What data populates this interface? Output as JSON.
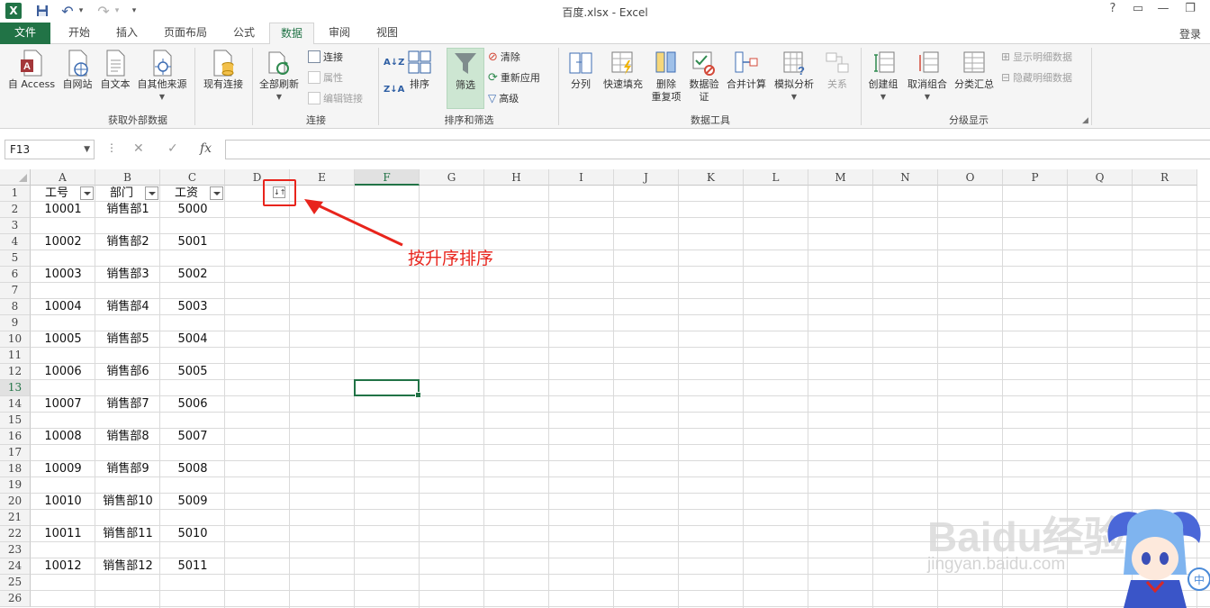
{
  "window": {
    "title": "百度.xlsx - Excel",
    "help": "?",
    "restore_ribbon": "▭",
    "minimize": "—",
    "restore": "❐"
  },
  "quick_access": {
    "excel_logo": "X",
    "save_tip": "save",
    "undo": "↶",
    "redo": "↷",
    "customize": "▾"
  },
  "tabs": [
    {
      "label": "文件",
      "kind": "file"
    },
    {
      "label": "开始"
    },
    {
      "label": "插入"
    },
    {
      "label": "页面布局"
    },
    {
      "label": "公式"
    },
    {
      "label": "数据",
      "active": true
    },
    {
      "label": "审阅"
    },
    {
      "label": "视图"
    }
  ],
  "account": {
    "login": "登录"
  },
  "ribbon": {
    "get_external": {
      "label": "获取外部数据",
      "access": "自 Access",
      "web": "自网站",
      "text": "自文本",
      "other": "自其他来源",
      "existing": "现有连接"
    },
    "connections": {
      "label": "连接",
      "refresh_all": "全部刷新",
      "connections": "连接",
      "properties": "属性",
      "edit_links": "编辑链接"
    },
    "sort_filter": {
      "label": "排序和筛选",
      "sort_az": "A↓Z",
      "sort_za": "Z↓A",
      "sort": "排序",
      "filter": "筛选",
      "clear": "清除",
      "reapply": "重新应用",
      "advanced": "高级"
    },
    "data_tools": {
      "label": "数据工具",
      "text_to_columns": "分列",
      "flash_fill": "快速填充",
      "remove_dup_1": "删除",
      "remove_dup_2": "重复项",
      "validation_1": "数据验",
      "validation_2": "证",
      "consolidate": "合并计算",
      "what_if": "模拟分析",
      "relationships": "关系"
    },
    "outline": {
      "label": "分级显示",
      "group": "创建组",
      "ungroup": "取消组合",
      "subtotal": "分类汇总",
      "show_detail": "显示明细数据",
      "hide_detail": "隐藏明细数据"
    }
  },
  "formula_bar": {
    "name_box": "F13",
    "cancel": "✕",
    "enter": "✓",
    "fx": "fx",
    "value": ""
  },
  "columns": [
    "A",
    "B",
    "C",
    "D",
    "E",
    "F",
    "G",
    "H",
    "I",
    "J",
    "K",
    "L",
    "M",
    "N",
    "O",
    "P",
    "Q",
    "R"
  ],
  "selected_column": "F",
  "rows": [
    "1",
    "2",
    "3",
    "4",
    "5",
    "6",
    "7",
    "8",
    "9",
    "10",
    "11",
    "12",
    "13",
    "14",
    "15",
    "16",
    "17",
    "18",
    "19",
    "20",
    "21",
    "22",
    "23",
    "24",
    "25",
    "26"
  ],
  "selected_row": "13",
  "sheet": {
    "headers": [
      "工号",
      "部门",
      "工资"
    ],
    "data_rows": [
      {
        "row": 2,
        "id": "10001",
        "dept": "销售部1",
        "salary": "5000"
      },
      {
        "row": 4,
        "id": "10002",
        "dept": "销售部2",
        "salary": "5001"
      },
      {
        "row": 6,
        "id": "10003",
        "dept": "销售部3",
        "salary": "5002"
      },
      {
        "row": 8,
        "id": "10004",
        "dept": "销售部4",
        "salary": "5003"
      },
      {
        "row": 10,
        "id": "10005",
        "dept": "销售部5",
        "salary": "5004"
      },
      {
        "row": 12,
        "id": "10006",
        "dept": "销售部6",
        "salary": "5005"
      },
      {
        "row": 14,
        "id": "10007",
        "dept": "销售部7",
        "salary": "5006"
      },
      {
        "row": 16,
        "id": "10008",
        "dept": "销售部8",
        "salary": "5007"
      },
      {
        "row": 18,
        "id": "10009",
        "dept": "销售部9",
        "salary": "5008"
      },
      {
        "row": 20,
        "id": "10010",
        "dept": "销售部10",
        "salary": "5009"
      },
      {
        "row": 22,
        "id": "10011",
        "dept": "销售部11",
        "salary": "5010"
      },
      {
        "row": 24,
        "id": "10012",
        "dept": "销售部12",
        "salary": "5011"
      }
    ]
  },
  "annotation": {
    "text": "按升序排序",
    "sort_glyph": "↓↑"
  },
  "watermark": {
    "main": "Baidu经验",
    "sub": "jingyan.baidu.com",
    "badge": "中"
  }
}
